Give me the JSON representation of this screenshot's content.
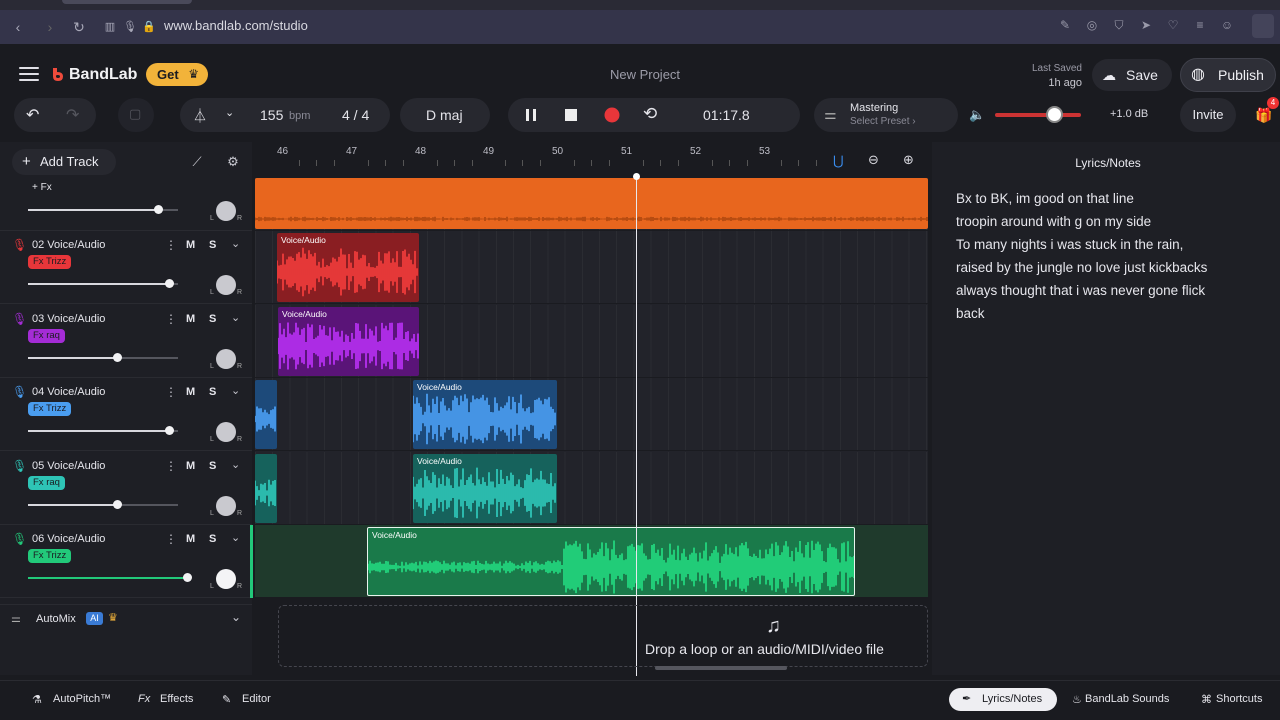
{
  "browser": {
    "url": "www.bandlab.com/studio"
  },
  "header": {
    "brand": "BandLab",
    "get_label": "Get",
    "project_title": "New Project",
    "last_saved_label": "Last Saved",
    "last_saved_time": "1h ago",
    "save_label": "Save",
    "publish_label": "Publish"
  },
  "transport": {
    "bpm_value": "155",
    "bpm_unit": "bpm",
    "time_signature": "4 / 4",
    "key": "D maj",
    "time": "01:17.8",
    "mastering_label": "Mastering",
    "mastering_preset": "Select Preset",
    "volume_db": "+1.0 dB",
    "volume_level": 0.7,
    "invite_label": "Invite",
    "gift_badge": "4"
  },
  "toolbar": {
    "add_track_label": "Add Track"
  },
  "ruler": {
    "bars": [
      "46",
      "47",
      "48",
      "49",
      "50",
      "51",
      "52",
      "53"
    ]
  },
  "tracks": [
    {
      "name": "",
      "fx_label": "+ Fx",
      "fx_color": "",
      "mic_color": "",
      "volume": 0.88
    },
    {
      "name": "02  Voice/Audio",
      "fx_label": "Fx Trizz",
      "fx_color": "#e8363a",
      "mic_color": "#e8363a",
      "volume": 0.96
    },
    {
      "name": "03  Voice/Audio",
      "fx_label": "Fx raq",
      "fx_color": "#a42cd6",
      "mic_color": "#a42cd6",
      "volume": 0.58
    },
    {
      "name": "04  Voice/Audio",
      "fx_label": "Fx Trizz",
      "fx_color": "#4a9df0",
      "mic_color": "#4a9df0",
      "volume": 0.96
    },
    {
      "name": "05  Voice/Audio",
      "fx_label": "Fx raq",
      "fx_color": "#2ec4b6",
      "mic_color": "#2ec4b6",
      "volume": 0.58
    },
    {
      "name": "06  Voice/Audio",
      "fx_label": "Fx Trizz",
      "fx_color": "#22c97a",
      "mic_color": "#22c97a",
      "volume": 1.09
    }
  ],
  "track_controls": {
    "mute": "M",
    "solo": "S",
    "pan_l": "L",
    "pan_r": "R"
  },
  "clips": {
    "label": "Voice/Audio"
  },
  "automix": {
    "label": "AutoMix",
    "ai_badge": "AI"
  },
  "drop_zone": {
    "text": "Drop a loop or an audio/MIDI/video file"
  },
  "notes": {
    "title": "Lyrics/Notes",
    "lines": [
      "Bx to BK, im good on that line",
      "troopin around with g on my side",
      "To many nights i was stuck in the rain,",
      "raised by the jungle no love just kickbacks",
      "always thought that i was never gone flick",
      "back"
    ]
  },
  "bottom_bar": {
    "autopitch": "AutoPitch™",
    "effects_prefix": "Fx",
    "effects": "Effects",
    "editor": "Editor",
    "lyrics_notes": "Lyrics/Notes",
    "sounds": "BandLab Sounds",
    "shortcuts": "Shortcuts"
  },
  "colors": {
    "accent_orange": "#e8661e",
    "get_yellow": "#f2b33a",
    "record_red": "#e8363a"
  }
}
